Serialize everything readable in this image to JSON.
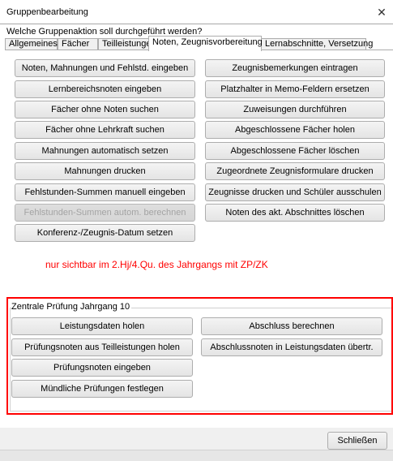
{
  "window": {
    "title": "Gruppenbearbeitung",
    "close_icon": "close-icon"
  },
  "question": "Welche Gruppenaktion soll durchgeführt werden?",
  "tabs": [
    {
      "label": "Allgemeines"
    },
    {
      "label": "Fächer"
    },
    {
      "label": "Teilleistungen"
    },
    {
      "label": "Noten, Zeugnisvorbereitung",
      "active": true
    },
    {
      "label": "Lernabschnitte, Versetzung"
    }
  ],
  "left_buttons": [
    {
      "label": "Noten, Mahnungen und Fehlstd. eingeben"
    },
    {
      "label": "Lernbereichsnoten eingeben"
    },
    {
      "label": "Fächer ohne Noten suchen"
    },
    {
      "label": "Fächer ohne Lehrkraft suchen"
    },
    {
      "label": "Mahnungen automatisch setzen"
    },
    {
      "label": "Mahnungen drucken"
    },
    {
      "label": "Fehlstunden-Summen manuell eingeben"
    },
    {
      "label": "Fehlstunden-Summen autom. berechnen",
      "disabled": true
    },
    {
      "label": "Konferenz-/Zeugnis-Datum setzen"
    }
  ],
  "right_buttons": [
    {
      "label": "Zeugnisbemerkungen eintragen"
    },
    {
      "label": "Platzhalter in Memo-Feldern ersetzen"
    },
    {
      "label": "Zuweisungen durchführen"
    },
    {
      "label": "Abgeschlossene Fächer holen"
    },
    {
      "label": "Abgeschlossene Fächer löschen"
    },
    {
      "label": "Zugeordnete Zeugnisformulare drucken"
    },
    {
      "label": "Zeugnisse drucken und Schüler ausschulen"
    },
    {
      "label": "Noten des akt. Abschnittes löschen"
    }
  ],
  "annotation": "nur sichtbar im 2.Hj/4.Qu. des Jahrgangs mit ZP/ZK",
  "zp_group": {
    "label": "Zentrale Prüfung Jahrgang 10",
    "left_buttons": [
      {
        "label": "Leistungsdaten holen"
      },
      {
        "label": "Prüfungsnoten aus Teilleistungen holen"
      },
      {
        "label": "Prüfungsnoten eingeben"
      },
      {
        "label": "Mündliche Prüfungen festlegen"
      }
    ],
    "right_buttons": [
      {
        "label": "Abschluss berechnen"
      },
      {
        "label": "Abschlussnoten in Leistungsdaten übertr."
      }
    ]
  },
  "footer": {
    "close_label": "Schließen"
  },
  "colors": {
    "annotation": "#ff0000",
    "highlight_box": "#ff0000",
    "active_tab_bg": "#ffffff",
    "button_border": "#adadad"
  }
}
